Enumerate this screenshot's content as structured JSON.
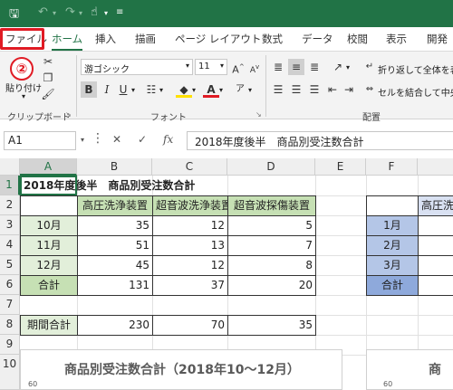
{
  "titlebar": {
    "icons": [
      "save-icon",
      "undo-icon",
      "redo-icon",
      "touch-mode-icon",
      "customize-qat-icon"
    ]
  },
  "ribbon_tabs": [
    "ファイル",
    "ホーム",
    "挿入",
    "描画",
    "ページ レイアウト",
    "数式",
    "データ",
    "校閲",
    "表示",
    "開発"
  ],
  "annotation": {
    "step": "②"
  },
  "ribbon": {
    "clipboard": {
      "paste_label": "貼り付け",
      "group_label": "クリップボード"
    },
    "font": {
      "font_name": "游ゴシック",
      "font_size": "11",
      "group_label": "フォント"
    },
    "alignment": {
      "wrap_text": "折り返して全体を表",
      "merge_center": "セルを結合して中央",
      "group_label": "配置"
    }
  },
  "formula_bar": {
    "name_box": "A1",
    "fx": "fx",
    "content": "2018年度後半　商品別受注数合計"
  },
  "sheet": {
    "columns": [
      "A",
      "B",
      "C",
      "D",
      "E",
      "F"
    ],
    "rows": [
      "1",
      "2",
      "3",
      "4",
      "5",
      "6",
      "7",
      "8",
      "9",
      "10"
    ],
    "title": "2018年度後半　商品別受注数合計",
    "headers": [
      "高圧洗浄装置",
      "超音波洗浄装置",
      "超音波探傷装置"
    ],
    "data_rows": [
      {
        "label": "10月",
        "values": [
          "35",
          "12",
          "5"
        ]
      },
      {
        "label": "11月",
        "values": [
          "51",
          "13",
          "7"
        ]
      },
      {
        "label": "12月",
        "values": [
          "45",
          "12",
          "8"
        ]
      }
    ],
    "total_row": {
      "label": "合計",
      "values": [
        "131",
        "37",
        "20"
      ]
    },
    "period_total": {
      "label": "期間合計",
      "values": [
        "230",
        "70",
        "35"
      ]
    },
    "right_table": {
      "header_partial": "高圧洗",
      "labels": [
        "1月",
        "2月",
        "3月",
        "合計"
      ]
    }
  },
  "charts": {
    "left_title": "商品別受注数合計（2018年10〜12月）",
    "left_axis_tick": "60",
    "right_title": "商",
    "right_axis_tick": "60"
  }
}
